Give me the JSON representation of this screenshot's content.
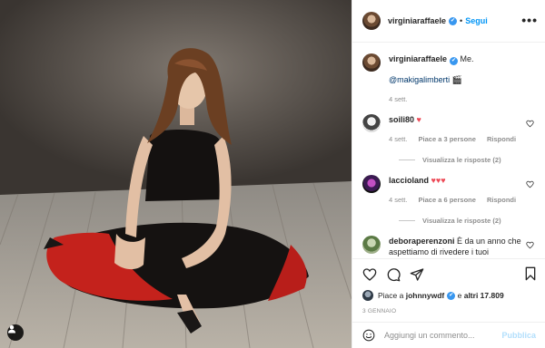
{
  "header": {
    "username": "virginiaraffaele",
    "verified_mark": "✔",
    "separator": "•",
    "follow_label": "Segui",
    "more_label": "•••"
  },
  "caption": {
    "username": "virginiaraffaele",
    "verified_mark": "✔",
    "text": "Me.",
    "mention": "@makigalimberti",
    "emoji": "🎬",
    "time": "4 sett."
  },
  "comments": [
    {
      "username": "soili80",
      "text": "♥",
      "time": "4 sett.",
      "likes": "Piace a 3 persone",
      "reply": "Rispondi",
      "view_replies": "Visualizza le risposte (2)"
    },
    {
      "username": "laccioland",
      "text": "♥♥♥",
      "time": "4 sett.",
      "likes": "Piace a 6 persone",
      "reply": "Rispondi",
      "view_replies": "Visualizza le risposte (2)"
    },
    {
      "username": "deboraperenzoni",
      "text": "È da un anno che aspettiamo di rivedere i tuoi"
    }
  ],
  "actions": {
    "like_icon": "heart-outline",
    "comment_icon": "speech-bubble",
    "share_icon": "paper-plane",
    "save_icon": "bookmark"
  },
  "likes": {
    "prefix": "Piace a",
    "user": "johnnywdf",
    "verified_mark": "✔",
    "suffix": "e",
    "others": "altri 17.809"
  },
  "date": "3 GENNAIO",
  "add_comment": {
    "placeholder": "Aggiungi un commento...",
    "publish_label": "Pubblica",
    "emoji_icon": "smiley"
  },
  "colors": {
    "accent": "#0095f6",
    "verified": "#3897f0",
    "heart": "#ed4956",
    "muted": "#8e8e8e"
  }
}
